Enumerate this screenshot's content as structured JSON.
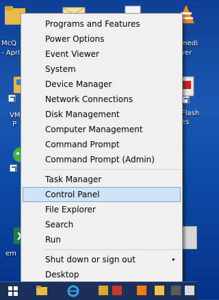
{
  "desktop": {
    "icons": [
      {
        "label": "McQ",
        "label2": "- Apri"
      },
      {
        "label": "medi",
        "label2": "yer"
      },
      {
        "label": "VM",
        "label2": "P"
      },
      {
        "label": "Flash",
        "label2": "es"
      },
      {
        "label": "em"
      }
    ]
  },
  "menu": {
    "items": [
      {
        "label": "Programs and Features"
      },
      {
        "label": "Power Options"
      },
      {
        "label": "Event Viewer"
      },
      {
        "label": "System"
      },
      {
        "label": "Device Manager"
      },
      {
        "label": "Network Connections"
      },
      {
        "label": "Disk Management"
      },
      {
        "label": "Computer Management"
      },
      {
        "label": "Command Prompt"
      },
      {
        "label": "Command Prompt (Admin)"
      },
      {
        "label": "Task Manager"
      },
      {
        "label": "Control Panel"
      },
      {
        "label": "File Explorer"
      },
      {
        "label": "Search"
      },
      {
        "label": "Run"
      },
      {
        "label": "Shut down or sign out",
        "submenu_arrow": "▸"
      },
      {
        "label": "Desktop"
      }
    ],
    "selected": "Control Panel"
  },
  "taskbar": {
    "start_icon": "windows-logo-icon",
    "pinned": [
      "file-explorer-icon",
      "internet-explorer-icon",
      "app-icon",
      "app-icon",
      "app-icon",
      "app-icon",
      "app-icon",
      "app-icon"
    ]
  },
  "colors": {
    "menu_bg": "#f0f0f0",
    "highlight": "#cfe3f7",
    "highlight_border": "#7da2ce",
    "taskbar": "#1c2f58"
  }
}
